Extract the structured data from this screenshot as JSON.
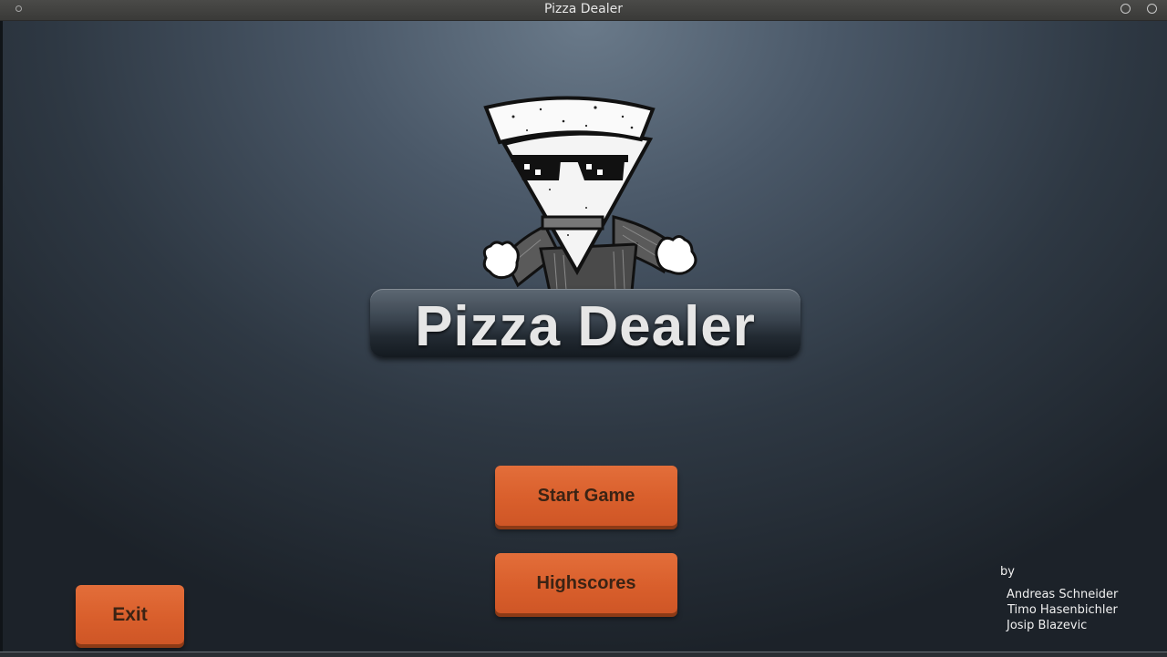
{
  "window": {
    "title": "Pizza Dealer"
  },
  "logo": {
    "text": "Pizza Dealer"
  },
  "menu": {
    "start_label": "Start Game",
    "highscores_label": "Highscores",
    "exit_label": "Exit"
  },
  "credits": {
    "by": "by",
    "names": [
      "Andreas Schneider",
      "Timo Hasenbichler",
      "Josip Blazevic"
    ]
  },
  "colors": {
    "button": "#d95f2c",
    "button_text": "#3b2314",
    "logo_text": "#e6e6e6",
    "background_top": "#6a7a8a",
    "background_bottom": "#1c2229"
  }
}
